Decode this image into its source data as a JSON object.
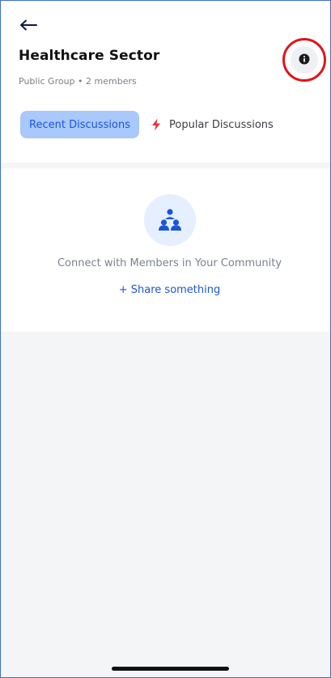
{
  "header": {
    "back_icon": "arrow-left-icon",
    "title": "Healthcare Sector",
    "meta": "Public Group • 2 members",
    "info_icon": "info-icon"
  },
  "tabs": [
    {
      "label": "Recent Discussions",
      "active": true
    },
    {
      "label": "Popular Discussions",
      "icon": "lightning-bolt-icon",
      "active": false
    }
  ],
  "empty_state": {
    "icon": "community-members-icon",
    "message": "Connect with Members in Your Community",
    "action_label": "+ Share something"
  },
  "colors": {
    "accent": "#1a56d6",
    "active_tab_bg": "#a9c8fb",
    "bolt": "#e8323a",
    "highlight_ring": "#e0141b"
  }
}
